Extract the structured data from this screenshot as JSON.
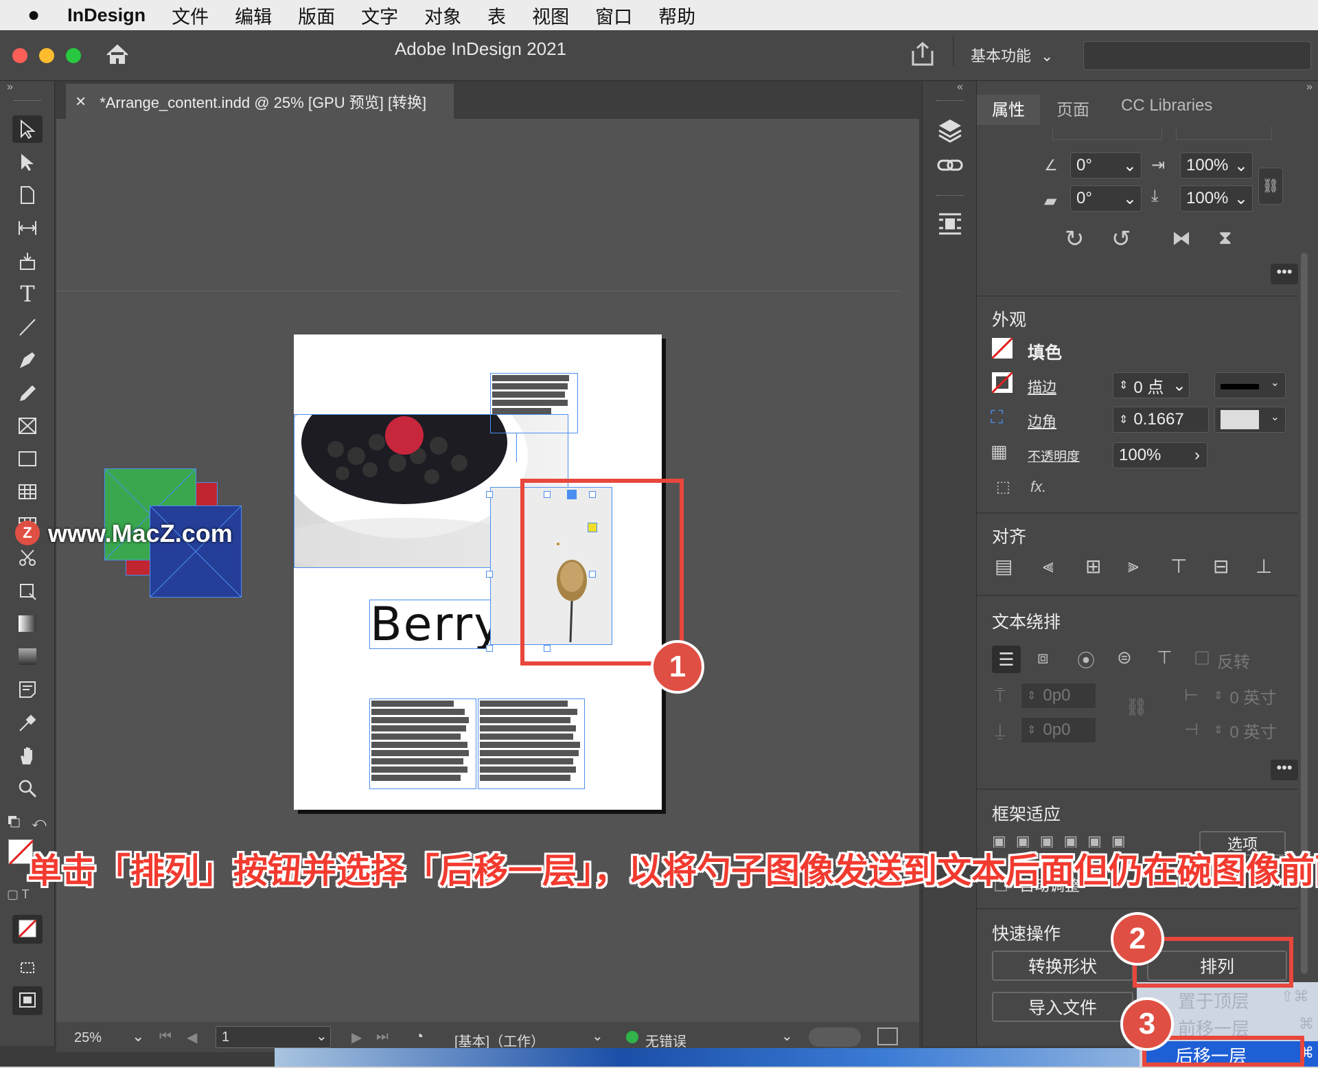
{
  "menubar": {
    "apple": "",
    "app": "InDesign",
    "items": [
      "文件",
      "编辑",
      "版面",
      "文字",
      "对象",
      "表",
      "视图",
      "窗口",
      "帮助"
    ]
  },
  "window": {
    "title": "Adobe InDesign 2021",
    "workspace": "基本功能"
  },
  "doc_tab": {
    "close": "×",
    "title": "*Arrange_content.indd @ 25% [GPU 预览] [转换]"
  },
  "page": {
    "headline": "Berry L"
  },
  "watermark": {
    "logo": "Z",
    "text": "www.MacZ.com"
  },
  "status": {
    "zoom": "25%",
    "page_number": "1",
    "profile": "[基本]（工作）",
    "errors": "无错误"
  },
  "panel": {
    "tabs": [
      "属性",
      "页面",
      "CC Libraries"
    ],
    "transform": {
      "rotate": "0°",
      "shear": "0°",
      "scale_x": "100%",
      "scale_y": "100%"
    },
    "appearance": {
      "title": "外观",
      "fill_label": "填色",
      "stroke_label": "描边",
      "stroke_value": "0 点",
      "corner_label": "边角",
      "corner_value": "0.1667",
      "opacity_label": "不透明度",
      "opacity_value": "100%",
      "fx": "fx."
    },
    "align": {
      "title": "对齐"
    },
    "text_wrap": {
      "title": "文本绕排",
      "invert_label": "反转",
      "top_offset": "0p0",
      "bottom_offset": "0p0",
      "left_offset": "0 英寸",
      "right_offset": "0 英寸"
    },
    "frame_fitting": {
      "title": "框架适应",
      "options": "选项",
      "auto_fit": "自动调整"
    },
    "quick_actions": {
      "title": "快速操作",
      "convert_shape": "转换形状",
      "arrange": "排列",
      "import_file": "导入文件"
    }
  },
  "arrange_menu": {
    "bring_to_front": "置于顶层",
    "bring_forward": "前移一层",
    "send_backward": "后移一层",
    "shortcut_front": "⇧⌘",
    "shortcut_forward": "⌘",
    "shortcut_backward": "⌘"
  },
  "annotation": {
    "caption": "单击「排列」按钮并选择「后移一层」，以将勺子图像发送到文本后面但仍在碗图像前面",
    "step1": "1",
    "step2": "2",
    "step3": "3"
  },
  "colors": {
    "accent": "#e8473c",
    "selection": "#4b8ef0",
    "menu_highlight": "#1f5fd6"
  }
}
